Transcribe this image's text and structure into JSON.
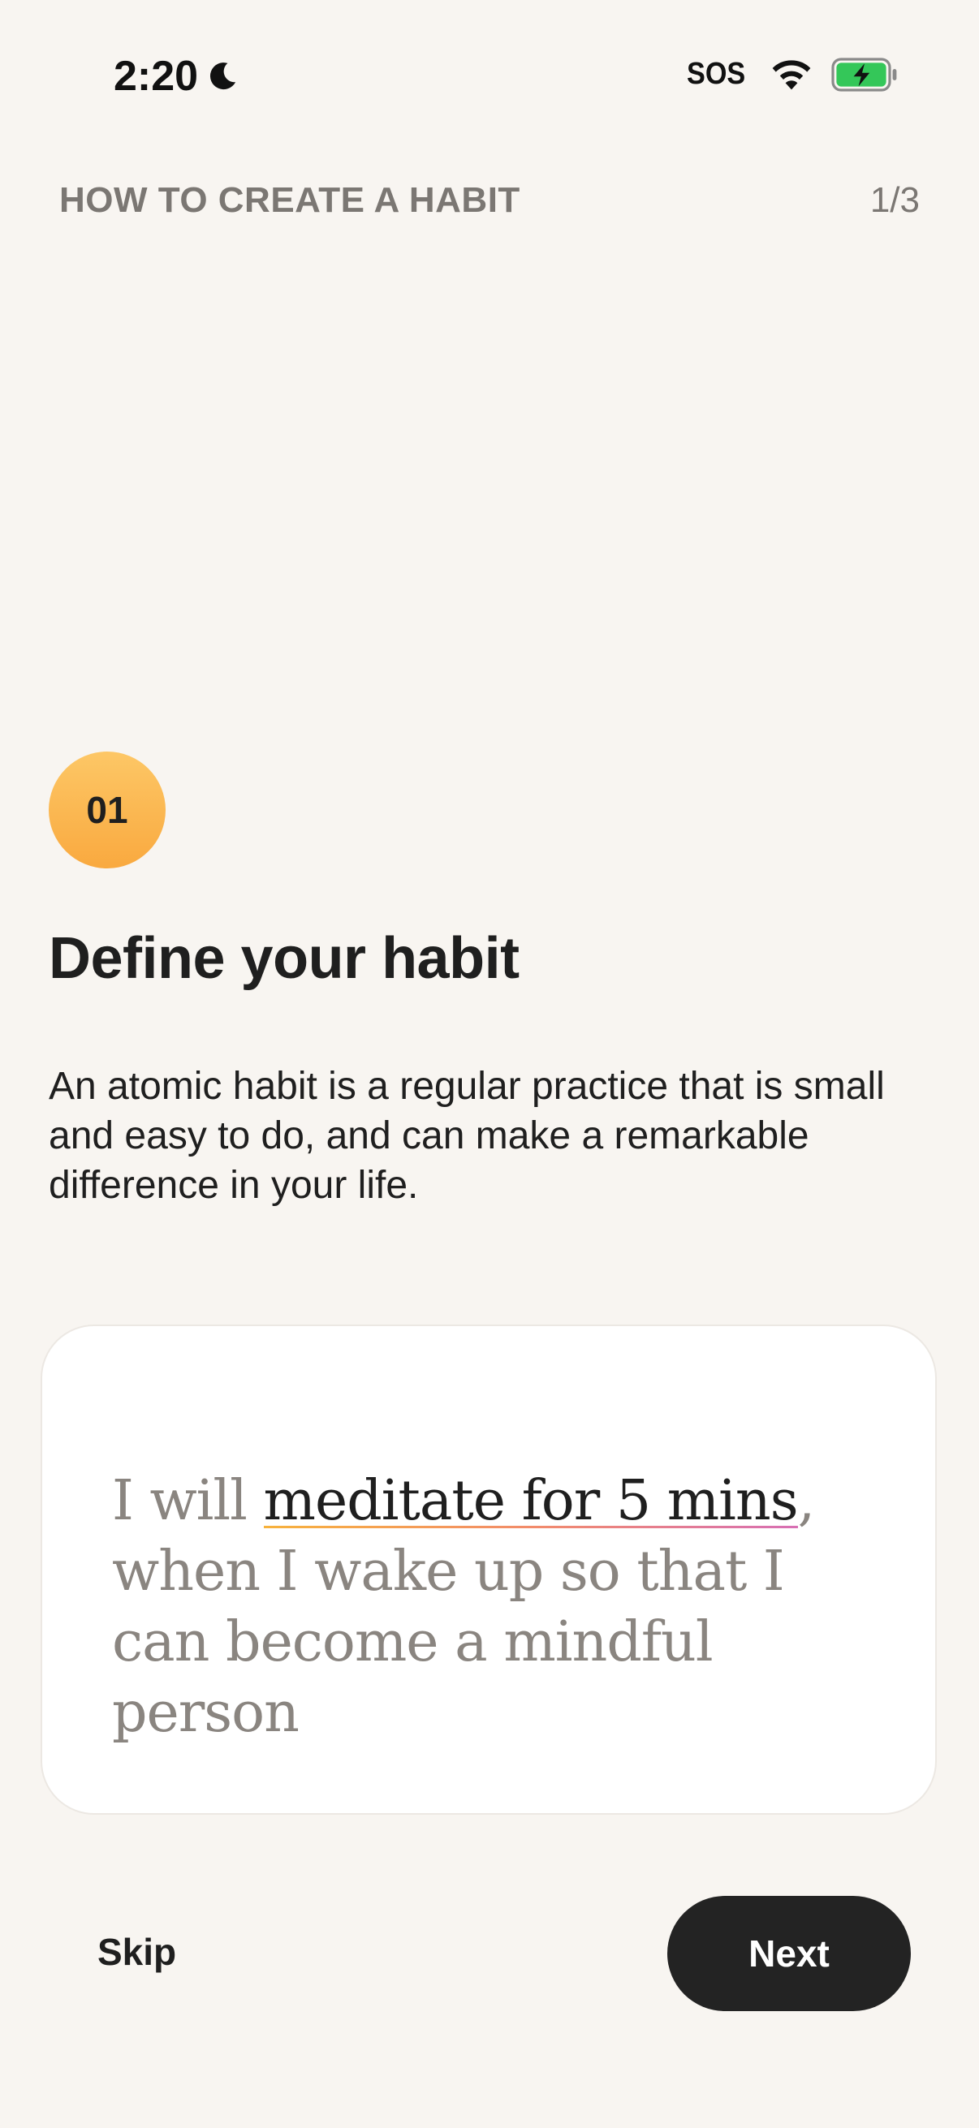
{
  "status_bar": {
    "time": "2:20",
    "sos_label": "SOS",
    "icons": [
      "moon-icon",
      "wifi-icon",
      "battery-charging-icon"
    ],
    "battery_color": "#34c759"
  },
  "header": {
    "title": "HOW TO CREATE A HABIT",
    "progress": "1/3"
  },
  "step": {
    "number": "01",
    "title": "Define your habit",
    "description": "An atomic habit is a regular practice that is small and easy to do, and can make a remarkable difference in your life.",
    "badge_color": "#f9b44a"
  },
  "example": {
    "prefix": "I will ",
    "action": "meditate for 5 mins",
    "middle": ", when I wake up so that I can become a mindful person"
  },
  "actions": {
    "skip_label": "Skip",
    "next_label": "Next"
  }
}
